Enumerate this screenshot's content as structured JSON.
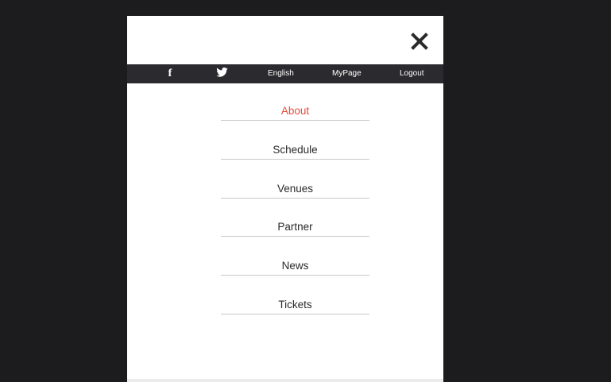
{
  "topbar": {
    "social": [
      {
        "icon": "facebook-icon",
        "glyph": "f"
      },
      {
        "icon": "twitter-icon"
      }
    ],
    "links": [
      {
        "label": "English"
      },
      {
        "label": "MyPage"
      },
      {
        "label": "Logout"
      }
    ]
  },
  "menu": {
    "items": [
      {
        "label": "About",
        "active": true
      },
      {
        "label": "Schedule",
        "active": false
      },
      {
        "label": "Venues",
        "active": false
      },
      {
        "label": "Partner",
        "active": false
      },
      {
        "label": "News",
        "active": false
      },
      {
        "label": "Tickets",
        "active": false
      }
    ]
  },
  "colors": {
    "background": "#1c1c1e",
    "panel": "#ffffff",
    "topbar": "#2b2b2f",
    "active": "#e74c3c",
    "text": "#2a2a2a"
  },
  "icons": {
    "close": "close-icon"
  }
}
